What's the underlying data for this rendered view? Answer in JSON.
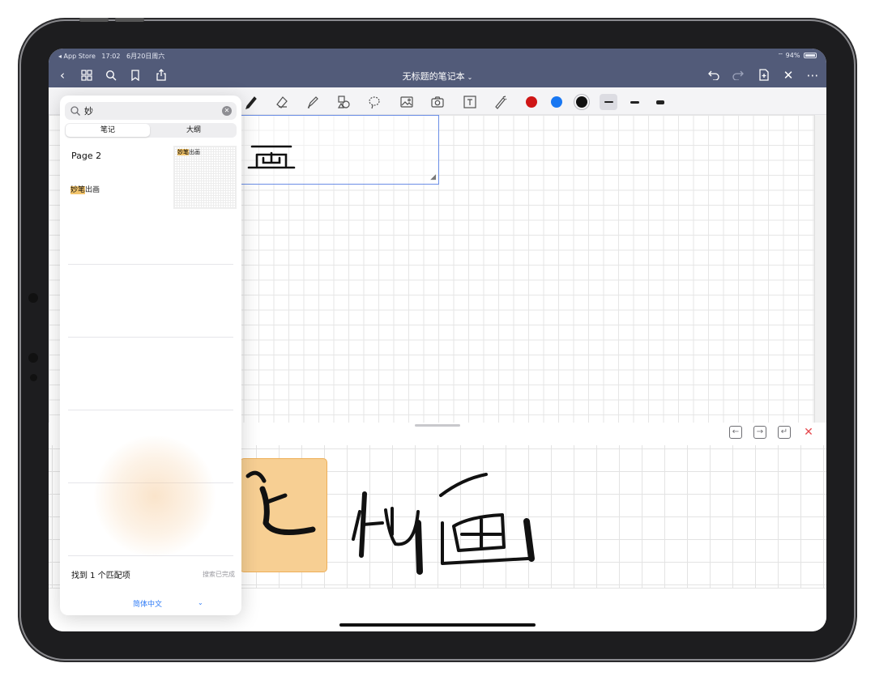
{
  "status_bar": {
    "back_app": "◂ App Store",
    "time": "17:02",
    "date": "6月20日周六",
    "wifi_battery": "94%"
  },
  "nav": {
    "title": "无标题的笔记本",
    "title_chevron": "⌄"
  },
  "toolbar": {
    "colors": [
      "#cf1616",
      "#1877f2",
      "#111111"
    ],
    "selected_color_index": 2
  },
  "search": {
    "query": "妙",
    "segments": [
      "笔记",
      "大纲"
    ],
    "active_segment": "笔记",
    "results": [
      {
        "page": "Page 2",
        "snippet_highlight": "妙笔",
        "snippet_rest": "出画",
        "thumb_highlight": "妙笔",
        "thumb_rest": "出画"
      }
    ],
    "match_count_text": "找到 1 个匹配项",
    "status_text": "搜索已完成",
    "language": "简体中文",
    "language_chevron": "⌄"
  },
  "accent_colors": {
    "nav_bar": "#525b79",
    "highlight": "#f7cf93",
    "link": "#2f7bf6",
    "close_red": "#e5484d"
  }
}
